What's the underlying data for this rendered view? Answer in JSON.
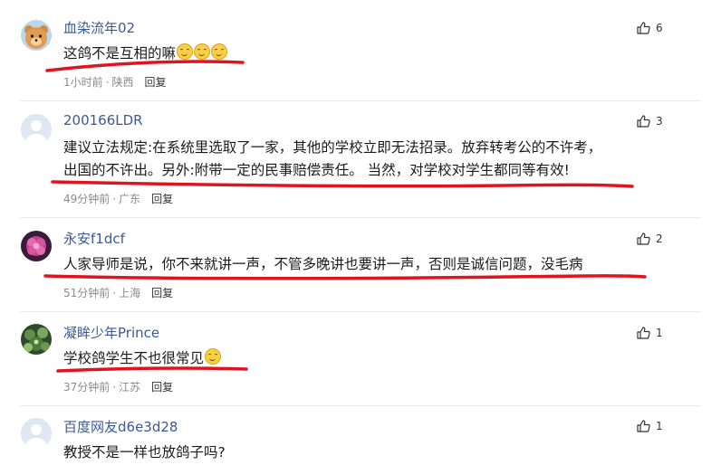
{
  "comments": [
    {
      "username": "血染流年02",
      "text": "这鸽不是互相的嘛",
      "emoji_icon": "smiling-face-emoji",
      "time": "1小时前",
      "location": "陕西",
      "reply": "回复",
      "likes": "6"
    },
    {
      "username": "200166LDR",
      "text_line1": "建议立法规定:在系统里选取了一家，其他的学校立即无法招录。放弃转考公的不许考，",
      "text_line2": "出国的不许出。另外:附带一定的民事赔偿责任。 当然，对学校对学生都同等有效!",
      "time": "49分钟前",
      "location": "广东",
      "reply": "回复",
      "likes": "3"
    },
    {
      "username": "永安f1dcf",
      "text": "人家导师是说，你不来就讲一声，不管多晚讲也要讲一声，否则是诚信问题，没毛病",
      "time": "51分钟前",
      "location": "上海",
      "reply": "回复",
      "likes": "2"
    },
    {
      "username": "凝眸少年Prince",
      "text": "学校鸽学生不也很常见",
      "emoji_icon": "smiling-face-emoji",
      "time": "37分钟前",
      "location": "江苏",
      "reply": "回复",
      "likes": "1"
    },
    {
      "username": "百度网友d6e3d28",
      "text": "教授不是一样也放鸽子吗?",
      "likes": "1"
    }
  ],
  "meta_separator": "·",
  "colors": {
    "username": "#3b5998",
    "underline": "#e0141e",
    "meta": "#8a8a8a"
  }
}
